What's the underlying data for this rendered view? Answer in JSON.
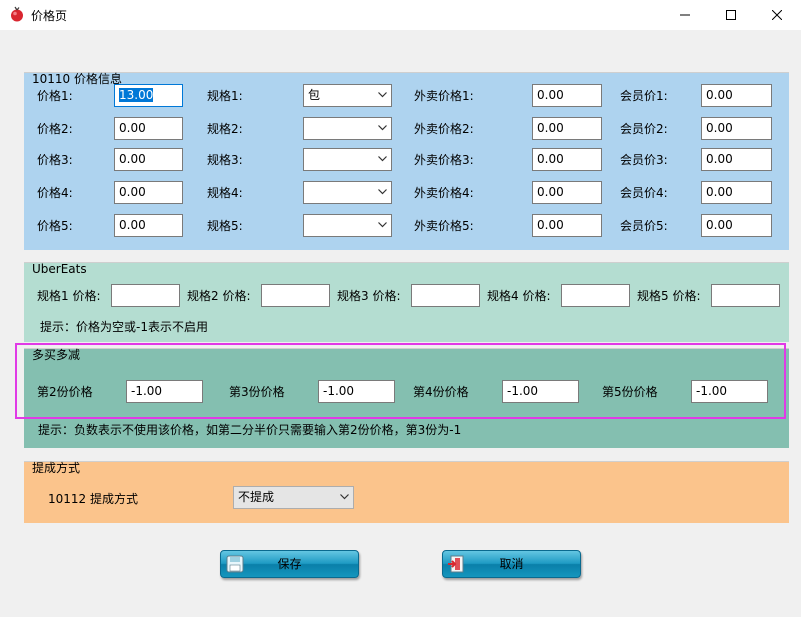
{
  "window": {
    "title": "价格页",
    "icon": "app-icon",
    "controls": [
      "minimize-icon",
      "maximize-icon",
      "close-icon"
    ]
  },
  "price_group": {
    "title": "10110 价格信息",
    "bg": "#aed3ef",
    "rows": [
      {
        "price_label": "价格1:",
        "price_value": "13.00",
        "spec_label": "规格1:",
        "spec_value": "包",
        "takeout_label": "外卖价格1:",
        "takeout_value": "0.00",
        "member_label": "会员价1:",
        "member_value": "0.00"
      },
      {
        "price_label": "价格2:",
        "price_value": "0.00",
        "spec_label": "规格2:",
        "spec_value": "",
        "takeout_label": "外卖价格2:",
        "takeout_value": "0.00",
        "member_label": "会员价2:",
        "member_value": "0.00"
      },
      {
        "price_label": "价格3:",
        "price_value": "0.00",
        "spec_label": "规格3:",
        "spec_value": "",
        "takeout_label": "外卖价格3:",
        "takeout_value": "0.00",
        "member_label": "会员价3:",
        "member_value": "0.00"
      },
      {
        "price_label": "价格4:",
        "price_value": "0.00",
        "spec_label": "规格4:",
        "spec_value": "",
        "takeout_label": "外卖价格4:",
        "takeout_value": "0.00",
        "member_label": "会员价4:",
        "member_value": "0.00"
      },
      {
        "price_label": "价格5:",
        "price_value": "0.00",
        "spec_label": "规格5:",
        "spec_value": "",
        "takeout_label": "外卖价格5:",
        "takeout_value": "0.00",
        "member_label": "会员价5:",
        "member_value": "0.00"
      }
    ]
  },
  "ubereats_group": {
    "title": "UberEats",
    "bg": "#b4ddd1",
    "specs": [
      {
        "label": "规格1 价格:",
        "value": ""
      },
      {
        "label": "规格2 价格:",
        "value": ""
      },
      {
        "label": "规格3 价格:",
        "value": ""
      },
      {
        "label": "规格4 价格:",
        "value": ""
      },
      {
        "label": "规格5 价格:",
        "value": ""
      }
    ],
    "hint": "提示：价格为空或-1表示不启用"
  },
  "multibuy_group": {
    "title": "多买多减",
    "bg": "#84bfb0",
    "items": [
      {
        "label": "第2份价格",
        "value": "-1.00"
      },
      {
        "label": "第3份价格",
        "value": "-1.00"
      },
      {
        "label": "第4份价格",
        "value": "-1.00"
      },
      {
        "label": "第5份价格",
        "value": "-1.00"
      }
    ],
    "hint": "提示：负数表示不使用该价格，如第二分半价只需要输入第2份价格，第3份为-1",
    "highlight_color": "#e03ae6"
  },
  "commission_group": {
    "title": "提成方式",
    "bg": "#fbc48c",
    "label": "10112 提成方式",
    "value": "不提成"
  },
  "buttons": {
    "save": {
      "label": "保存",
      "icon": "save-icon"
    },
    "cancel": {
      "label": "取消",
      "icon": "exit-icon"
    }
  }
}
